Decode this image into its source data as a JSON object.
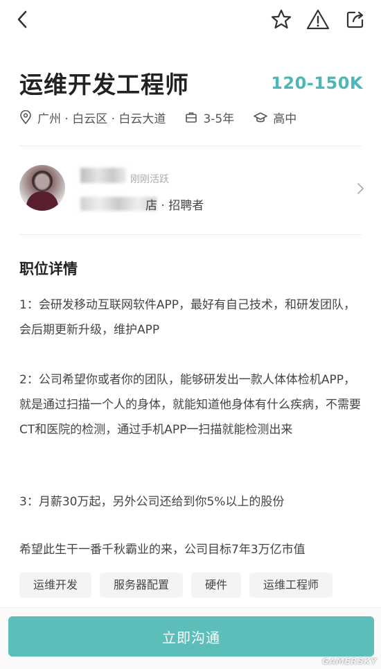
{
  "job": {
    "title": "运维开发工程师",
    "salary": "120-150K",
    "location": "广州 · 白云区 · 白云大道",
    "experience": "3-5年",
    "education": "高中"
  },
  "recruiter": {
    "status": "刚刚活跃",
    "company_suffix": "店 · 招聘者"
  },
  "details": {
    "section_title": "职位详情",
    "paragraphs": [
      "1：会研发移动互联网软件APP，最好有自己技术，和研发团队，会后期更新升级，维护APP",
      "2：公司希望你或者你的团队，能够研发出一款人体体检机APP，就是通过扫描一个人的身体，就能知道他身体有什么疾病，不需要CT和医院的检测，通过手机APP一扫描就能检测出来",
      "3：月薪30万起，另外公司还给到你5%以上的股份",
      "希望此生干一番千秋霸业的来，公司目标7年3万亿市值"
    ]
  },
  "tags": [
    "运维开发",
    "服务器配置",
    "硬件",
    "运维工程师"
  ],
  "action": {
    "chat_label": "立即沟通"
  },
  "watermark": "GAMERSKY",
  "colors": {
    "accent": "#4db6b6",
    "button": "#5dbdb8"
  },
  "icons": [
    "back-icon",
    "star-icon",
    "warning-icon",
    "share-icon",
    "location-icon",
    "briefcase-icon",
    "graduation-cap-icon",
    "chevron-right-icon"
  ]
}
